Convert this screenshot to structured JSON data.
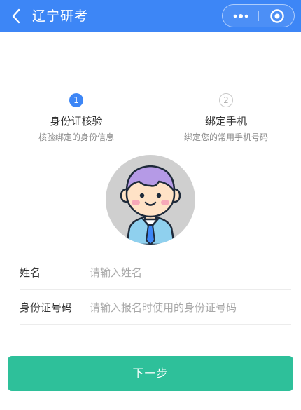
{
  "nav": {
    "title": "辽宁研考",
    "back_icon": "chevron-left-icon",
    "menu_icon": "more-dots-icon",
    "close_icon": "circle-target-icon",
    "color": "#3d86f6"
  },
  "steps": [
    {
      "number": "1",
      "title": "身份证核验",
      "subtitle": "核验绑定的身份信息",
      "active": true
    },
    {
      "number": "2",
      "title": "绑定手机",
      "subtitle": "绑定您的常用手机号码",
      "active": false
    }
  ],
  "avatar": {
    "icon": "user-avatar-icon"
  },
  "form": {
    "name": {
      "label": "姓名",
      "value": "",
      "placeholder": "请输入姓名"
    },
    "idcard": {
      "label": "身份证号码",
      "value": "",
      "placeholder": "请输入报名时使用的身份证号码"
    }
  },
  "next_button": {
    "label": "下一步",
    "color": "#2ec09a"
  }
}
